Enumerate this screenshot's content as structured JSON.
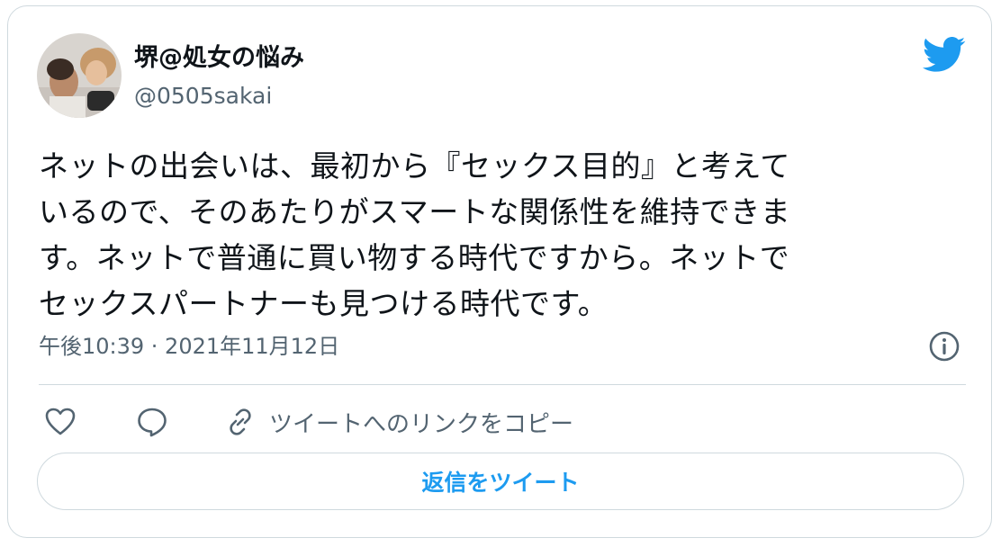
{
  "author": {
    "display_name": "堺@処女の悩み",
    "handle": "@0505sakai",
    "avatar_icon": "user-avatar"
  },
  "brand": {
    "logo_icon": "twitter-bird-icon",
    "accent_color": "#1d9bf0"
  },
  "tweet": {
    "lines": [
      "ネットの出会いは、最初から『セックス目的』と考えて",
      "いるので、そのあたりがスマートな関係性を維持できま",
      "す。ネットで普通に買い物する時代ですから。ネットで",
      "セックスパートナーも見つける時代です。"
    ],
    "timestamp": "午後10:39 · 2021年11月12日"
  },
  "actions": {
    "like_icon": "heart-icon",
    "reply_icon": "speech-bubble-icon",
    "copy_link_icon": "link-icon",
    "copy_link_label": "ツイートへのリンクをコピー",
    "info_icon": "info-icon"
  },
  "reply_button": {
    "label": "返信をツイート"
  }
}
